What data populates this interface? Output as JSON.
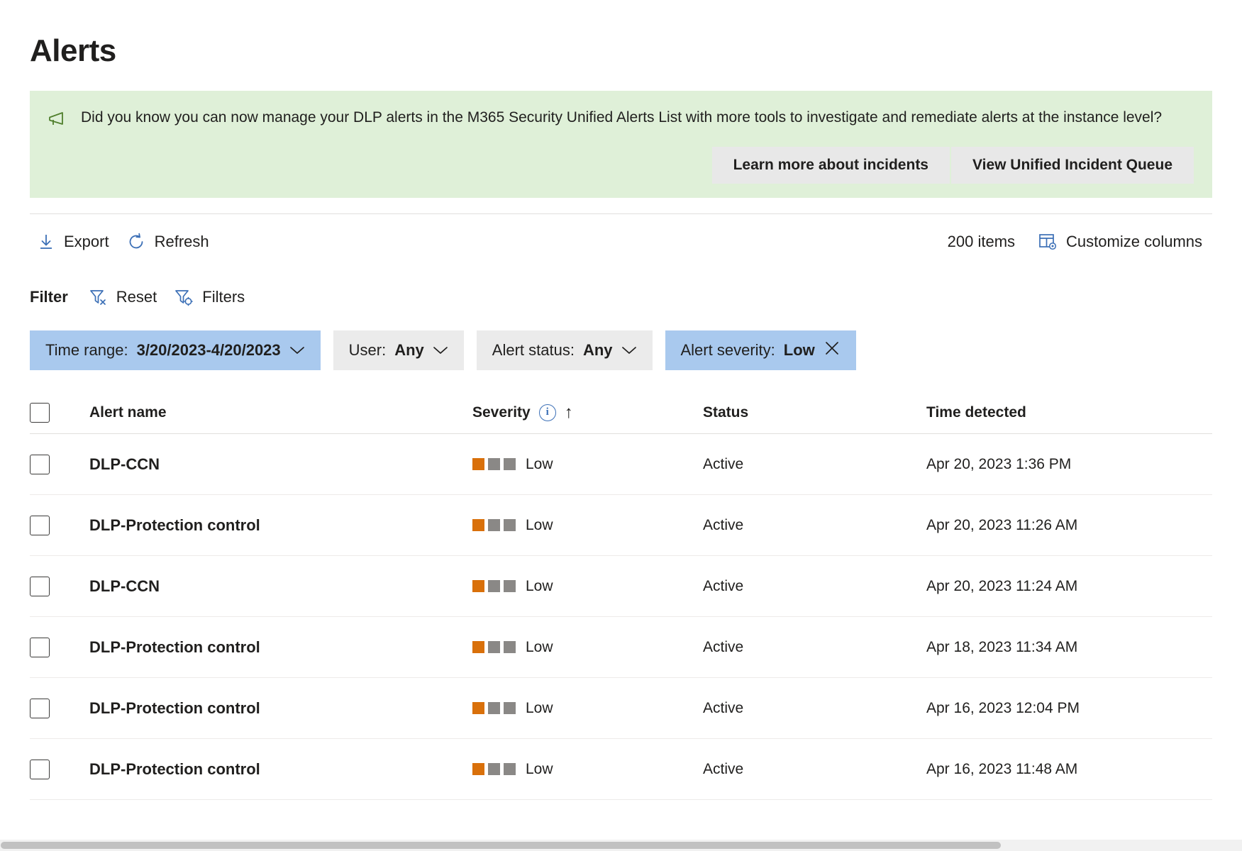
{
  "page": {
    "title": "Alerts"
  },
  "banner": {
    "icon": "megaphone-icon",
    "message": "Did you know you can now manage your DLP alerts in the M365 Security Unified Alerts List with more tools to investigate and remediate alerts at the instance level?",
    "buttons": [
      {
        "label": "Learn more about incidents",
        "name": "learn-more-about-incidents-button"
      },
      {
        "label": "View Unified Incident Queue",
        "name": "view-unified-incident-queue-button"
      }
    ],
    "background_color": "#dff0d8",
    "icon_color": "#507f2d"
  },
  "commandbar": {
    "export_label": "Export",
    "refresh_label": "Refresh",
    "items_count": "200 items",
    "customize_columns_label": "Customize columns"
  },
  "filterbar": {
    "label": "Filter",
    "reset_label": "Reset",
    "filters_label": "Filters"
  },
  "filter_pills": [
    {
      "key": "Time range:",
      "value": "3/20/2023-4/20/2023",
      "active": true,
      "trailing": "chevron-down-icon",
      "name": "filter-pill-time-range"
    },
    {
      "key": "User:",
      "value": "Any",
      "active": false,
      "trailing": "chevron-down-icon",
      "name": "filter-pill-user"
    },
    {
      "key": "Alert status:",
      "value": "Any",
      "active": false,
      "trailing": "chevron-down-icon",
      "name": "filter-pill-alert-status"
    },
    {
      "key": "Alert severity:",
      "value": "Low",
      "active": true,
      "trailing": "close-icon",
      "name": "filter-pill-alert-severity"
    }
  ],
  "table": {
    "columns": {
      "alert_name": "Alert name",
      "severity": "Severity",
      "status": "Status",
      "time_detected": "Time detected"
    },
    "sort_indicator": "↑",
    "severity_colors": {
      "filled": "#d9700a",
      "empty": "#8a8886"
    },
    "rows": [
      {
        "name": "DLP-CCN",
        "severity": "Low",
        "severity_level": 1,
        "status": "Active",
        "time": "Apr 20, 2023 1:36 PM"
      },
      {
        "name": "DLP-Protection control",
        "severity": "Low",
        "severity_level": 1,
        "status": "Active",
        "time": "Apr 20, 2023 11:26 AM"
      },
      {
        "name": "DLP-CCN",
        "severity": "Low",
        "severity_level": 1,
        "status": "Active",
        "time": "Apr 20, 2023 11:24 AM"
      },
      {
        "name": "DLP-Protection control",
        "severity": "Low",
        "severity_level": 1,
        "status": "Active",
        "time": "Apr 18, 2023 11:34 AM"
      },
      {
        "name": "DLP-Protection control",
        "severity": "Low",
        "severity_level": 1,
        "status": "Active",
        "time": "Apr 16, 2023 12:04 PM"
      },
      {
        "name": "DLP-Protection control",
        "severity": "Low",
        "severity_level": 1,
        "status": "Active",
        "time": "Apr 16, 2023 11:48 AM"
      }
    ]
  },
  "colors": {
    "accent": "#3b6fb6",
    "pill_active": "#a9c9ee",
    "pill_inactive": "#ebebeb"
  }
}
